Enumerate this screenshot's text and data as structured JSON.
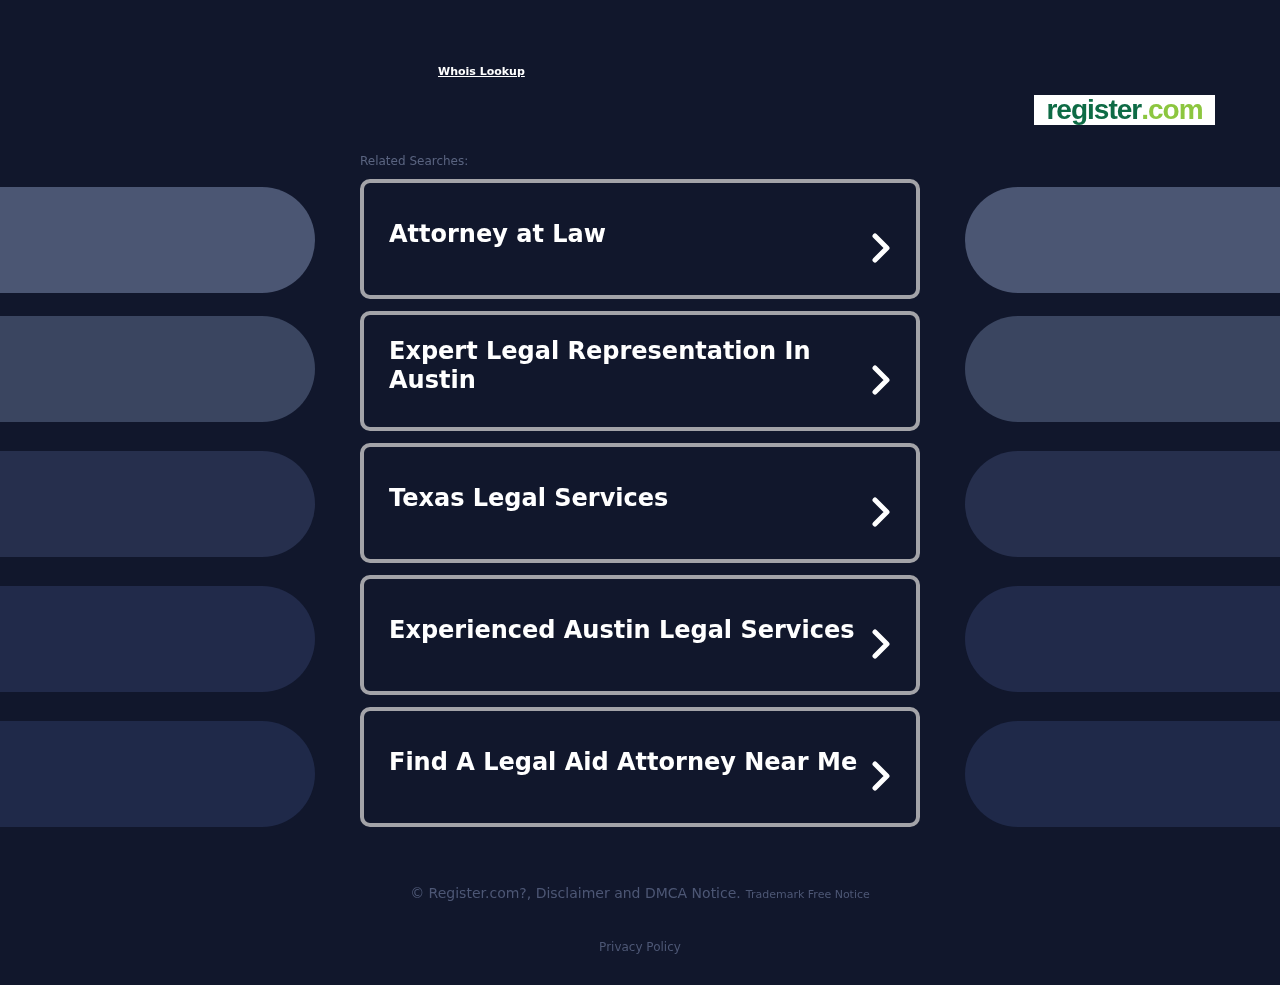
{
  "header": {
    "link": "Whois Lookup",
    "logo": {
      "name": "register",
      "suffix": ".com"
    }
  },
  "related": {
    "heading": "Related Searches:",
    "items": [
      {
        "label": "Attorney at Law"
      },
      {
        "label": "Expert Legal Representation In Austin"
      },
      {
        "label": "Texas Legal Services"
      },
      {
        "label": "Experienced Austin Legal Services"
      },
      {
        "label": "Find A Legal Aid Attorney Near Me"
      }
    ]
  },
  "footer": {
    "notice": "© Register.com?, Disclaimer and DMCA Notice.",
    "trademark": "Trademark Free Notice",
    "privacy": "Privacy Policy"
  }
}
